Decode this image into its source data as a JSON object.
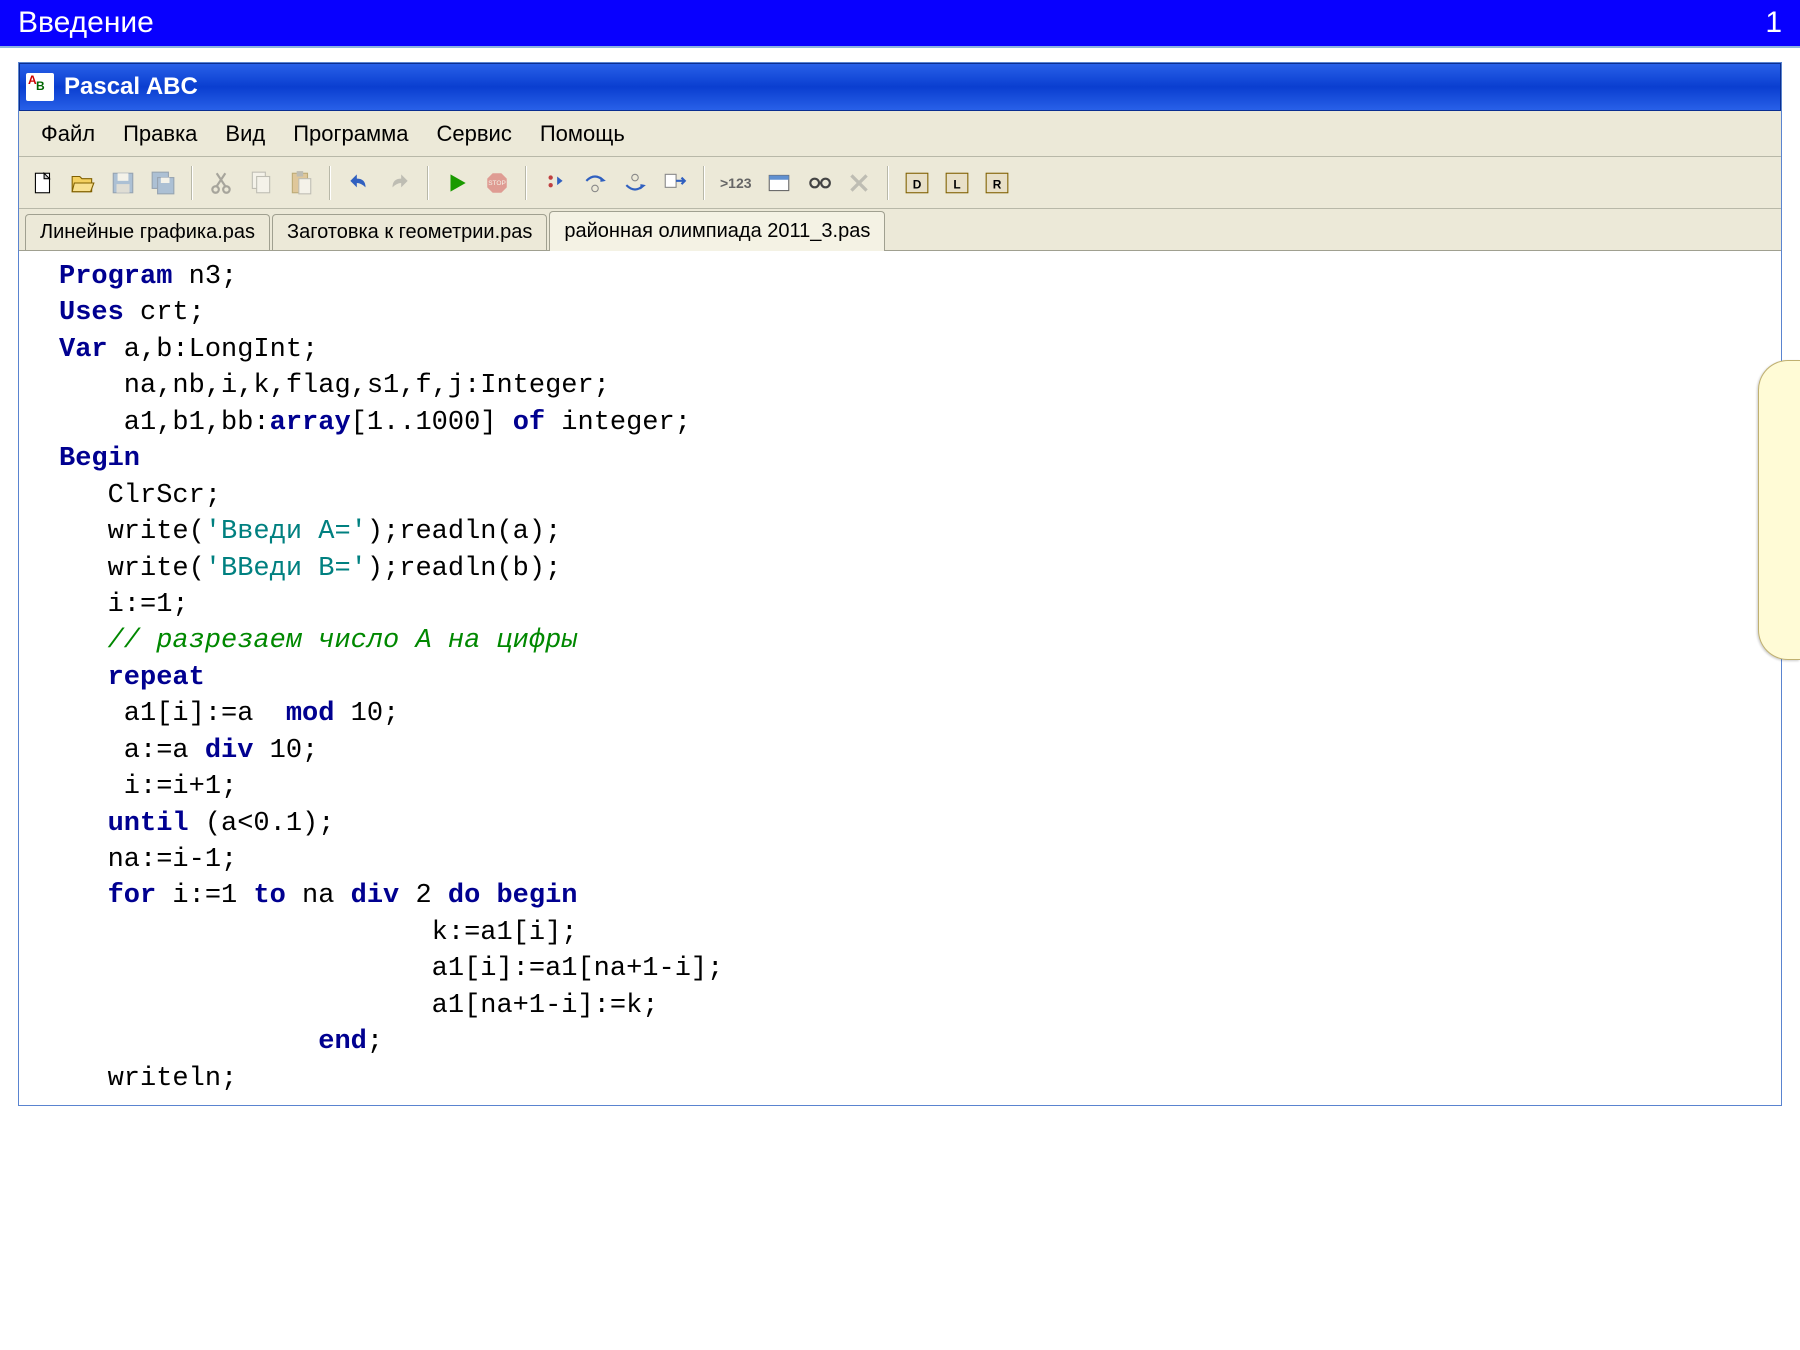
{
  "slide": {
    "title": "Введение",
    "number": "1"
  },
  "window": {
    "title": "Pascal ABC"
  },
  "menu": {
    "file": "Файл",
    "edit": "Правка",
    "view": "Вид",
    "program": "Программа",
    "tools": "Сервис",
    "help": "Помощь"
  },
  "toolbar": {
    "new": "new-file",
    "open": "open-file",
    "save": "save",
    "saveall": "save-all",
    "cut": "cut",
    "copy": "copy",
    "paste": "paste",
    "undo": "undo",
    "redo": "redo",
    "run": "run",
    "stop": "stop",
    "stepover": "step-over",
    "stepinto": "step-into",
    "stepout": "step-out",
    "tocursor": "run-to-cursor",
    "evalvars": ">123",
    "window": "window",
    "watch": "watch",
    "delete": "delete",
    "vd": "vd",
    "vl": "vl",
    "vr": "vr"
  },
  "tabs": {
    "t1": "Линейные графика.pas",
    "t2": "Заготовка к геометрии.pas",
    "t3": "районная олимпиада 2011_3.pas"
  },
  "code": {
    "l1a": "Program",
    "l1b": " n3;",
    "l2a": "Uses",
    "l2b": " crt;",
    "l3a": "Var",
    "l3b": " a,b:LongInt;",
    "l4": "    na,nb,i,k,flag,s1,f,j:Integer;",
    "l5a": "    a1,b1,bb:",
    "l5b": "array",
    "l5c": "[1..1000] ",
    "l5d": "of",
    "l5e": " integer;",
    "l6": "Begin",
    "l7": "   ClrScr;",
    "l8a": "   write(",
    "l8b": "'Введи A='",
    "l8c": ");readln(a);",
    "l9a": "   write(",
    "l9b": "'ВВеди B='",
    "l9c": ");readln(b);",
    "l10": "   i:=1;",
    "l11": "   // разрезаем число A на цифры",
    "l12": "   repeat",
    "l13a": "    a1[i]:=a  ",
    "l13b": "mod",
    "l13c": " 10;",
    "l14a": "    a:=a ",
    "l14b": "div",
    "l14c": " 10;",
    "l15": "    i:=i+1;",
    "l16a": "   until",
    "l16b": " (a<0.1);",
    "l17": "   na:=i-1;",
    "l18a": "   for",
    "l18b": " i:=1 ",
    "l18c": "to",
    "l18d": " na ",
    "l18e": "div",
    "l18f": " 2 ",
    "l18g": "do begin",
    "l19": "                       k:=a1[i];",
    "l20": "                       a1[i]:=a1[na+1-i];",
    "l21": "                       a1[na+1-i]:=k;",
    "l22a": "                ",
    "l22b": "end",
    "l22c": ";",
    "l23": "   writeln;"
  }
}
